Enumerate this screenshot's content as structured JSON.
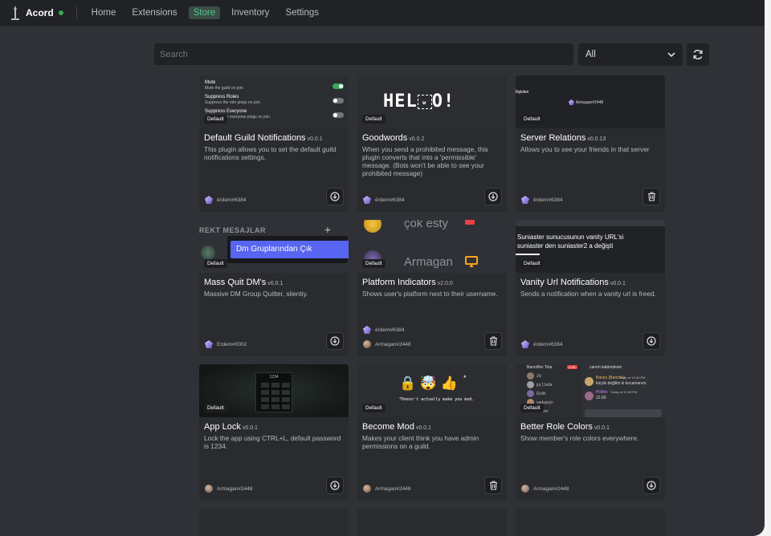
{
  "app": {
    "name": "Acord"
  },
  "nav": {
    "tabs": [
      {
        "label": "Home"
      },
      {
        "label": "Extensions"
      },
      {
        "label": "Store"
      },
      {
        "label": "Inventory"
      },
      {
        "label": "Settings"
      }
    ],
    "active": "Store"
  },
  "search": {
    "placeholder": "Search",
    "value": ""
  },
  "filter": {
    "selected": "All"
  },
  "cards": [
    {
      "title": "Default Guild Notifications",
      "version": "v0.0.1",
      "badge": "Default",
      "description": "This plugin allows you to set the default guild notifications settings.",
      "author": "ërdem#6384",
      "action": "download",
      "preview": {
        "settings": [
          {
            "label": "Mute",
            "sub": "Mute the guild on join."
          },
          {
            "label": "Suppress Roles",
            "sub": "Suppress the role pings on join."
          },
          {
            "label": "Suppress Everyone",
            "sub": "Suppress the everyone pings on join."
          }
        ]
      }
    },
    {
      "title": "Goodwords",
      "version": "v0.0.2",
      "badge": "Default",
      "description": "When you send a prohibited message, this plugin converts that into a 'permissible' message. (Bots won't be able to see your prohibited message)",
      "author": "ërdem#6384",
      "action": "download",
      "preview": {
        "headline": "HEL",
        "headline_end": "O!",
        "box_text": "w"
      }
    },
    {
      "title": "Server Relations",
      "version": "v0.0.13",
      "badge": "Default",
      "description": "Allows you to see your friends in that server",
      "author": "ërdem#6384",
      "action": "delete",
      "preview": {
        "label": "İlişkileri",
        "chip": "Armagan#2448"
      }
    },
    {
      "title": "Mass Quit DM's",
      "version": "v0.0.1",
      "badge": "Default",
      "description": "Massive DM Group Quitter, slientiy.",
      "author": "Erdem#0002",
      "action": "download",
      "preview": {
        "header": "REKT MESAJLAR",
        "menu_item": "Dm Gruplarından Çık"
      }
    },
    {
      "title": "Platform Indicators",
      "version": "v2.0.0",
      "badge": "Default",
      "description": "Shows user's platform next to their username.",
      "authors": [
        "ërdem#6384",
        "Armagan#2448"
      ],
      "action": "delete",
      "preview": {
        "user1": "çok esty",
        "user2": "Armagan"
      }
    },
    {
      "title": "Vanity Url Notifications",
      "version": "v0.0.1",
      "badge": "Default",
      "description": "Sends a notification when a vanity url is freed.",
      "author": "ërdem#6384",
      "action": "download",
      "preview": {
        "line1": "Suniaster sunucusunun vanity URL'si",
        "line2": "suniaster den suniaster2 a değişti"
      }
    },
    {
      "title": "App Lock",
      "version": "v0.0.1",
      "badge": "Default",
      "description": "Lock the app using CTRL+L, default password is 1234.",
      "author": "Armagan#2448",
      "action": "download",
      "preview": {
        "pin": "1234"
      }
    },
    {
      "title": "Become Mod",
      "version": "v0.0.1",
      "badge": "Default",
      "description": "Makes your client think you have admin permissions on a guild.",
      "author": "Armagan#2448",
      "action": "delete",
      "preview": {
        "emojis": "🔒 🤯 👍",
        "caption": "*Doesn't actually make you mod."
      }
    },
    {
      "title": "Better Role Colors",
      "version": "v0.0.1",
      "badge": "Default",
      "description": "Show member's role colors everywhere.",
      "author": "Armagan#2448",
      "action": "download",
      "preview": {
        "header": "canım kabimdesin",
        "members": [
          "BannWer Tola",
          "Jiz",
          "joj 11ella",
          "Elclik",
          "sadaşiçin",
          "ouWer"
        ],
        "live": "LIVE",
        "msg1_author": "Banzu (Bancha)",
        "msg1_time": "Today at 10:49 PM",
        "msg1_text": "küçük değilim ki kocamanım",
        "msg2_author": "PinBin",
        "msg2_time": "Today at 10:49 PM",
        "msg2_text": "12.60"
      }
    }
  ],
  "colors": {
    "accent": "#52c68f",
    "background": "#2f3136",
    "card": "#292b2f",
    "topbar": "#202225"
  }
}
